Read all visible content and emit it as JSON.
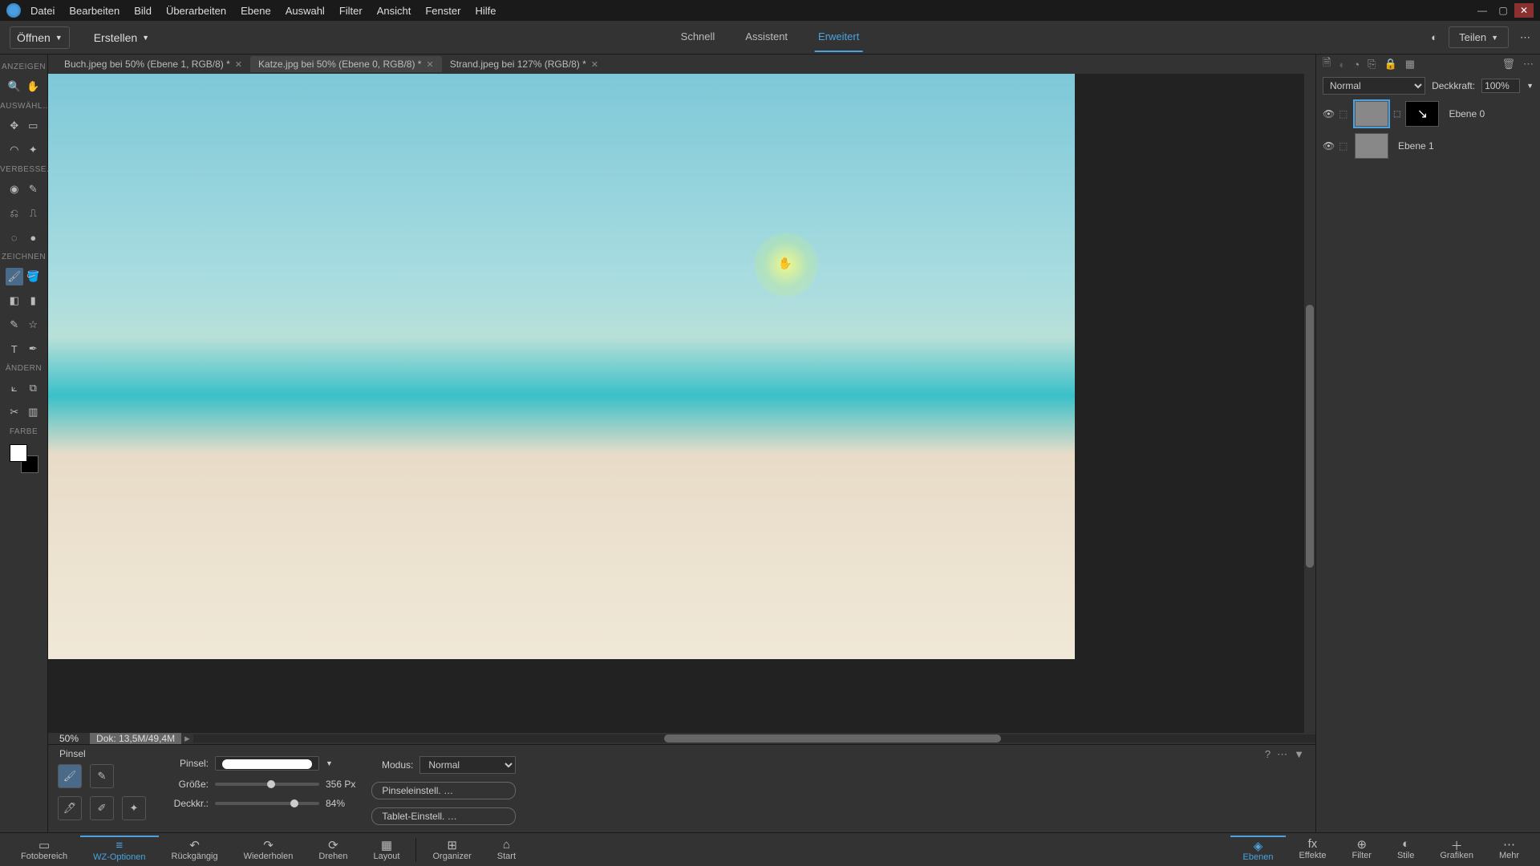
{
  "menu": [
    "Datei",
    "Bearbeiten",
    "Bild",
    "Überarbeiten",
    "Ebene",
    "Auswahl",
    "Filter",
    "Ansicht",
    "Fenster",
    "Hilfe"
  ],
  "actionbar": {
    "open": "Öffnen",
    "create": "Erstellen",
    "tabs": [
      "Schnell",
      "Assistent",
      "Erweitert"
    ],
    "active_tab": 2,
    "share": "Teilen"
  },
  "toolsections": {
    "anzeigen": "ANZEIGEN",
    "auswahl": "AUSWÄHL…",
    "verbessern": "VERBESSE…",
    "zeichnen": "ZEICHNEN",
    "andern": "ÄNDERN",
    "farbe": "FARBE"
  },
  "doctabs": [
    {
      "label": "Buch.jpeg bei 50% (Ebene 1, RGB/8) *",
      "active": false
    },
    {
      "label": "Katze.jpg bei 50% (Ebene 0, RGB/8) *",
      "active": true
    },
    {
      "label": "Strand.jpeg bei 127% (RGB/8) *",
      "active": false
    }
  ],
  "status": {
    "zoom": "50%",
    "doc": "Dok: 13,5M/49,4M"
  },
  "options": {
    "title": "Pinsel",
    "brush_label": "Pinsel:",
    "size_label": "Größe:",
    "size_value": "356 Px",
    "opacity_label": "Deckkr.:",
    "opacity_value": "84%",
    "mode_label": "Modus:",
    "mode_value": "Normal",
    "btn_brush": "Pinseleinstell. …",
    "btn_tablet": "Tablet-Einstell. …"
  },
  "layers": {
    "blend_mode": "Normal",
    "opacity_label": "Deckkraft:",
    "opacity_value": "100%",
    "items": [
      {
        "name": "Ebene 0",
        "active": true,
        "has_mask": true
      },
      {
        "name": "Ebene 1",
        "active": false,
        "has_mask": false
      }
    ]
  },
  "bottombar": {
    "left": [
      {
        "label": "Fotobereich",
        "icon": "▭"
      },
      {
        "label": "WZ-Optionen",
        "icon": "≡",
        "active": true
      },
      {
        "label": "Rückgängig",
        "icon": "↶"
      },
      {
        "label": "Wiederholen",
        "icon": "↷"
      },
      {
        "label": "Drehen",
        "icon": "⟳"
      },
      {
        "label": "Layout",
        "icon": "▦"
      }
    ],
    "mid": [
      {
        "label": "Organizer",
        "icon": "⊞"
      },
      {
        "label": "Start",
        "icon": "⌂"
      }
    ],
    "right": [
      {
        "label": "Ebenen",
        "icon": "◈",
        "active": true
      },
      {
        "label": "Effekte",
        "icon": "fx"
      },
      {
        "label": "Filter",
        "icon": "⊕"
      },
      {
        "label": "Stile",
        "icon": "◐"
      },
      {
        "label": "Grafiken",
        "icon": "＋"
      },
      {
        "label": "Mehr",
        "icon": "⋯"
      }
    ]
  }
}
